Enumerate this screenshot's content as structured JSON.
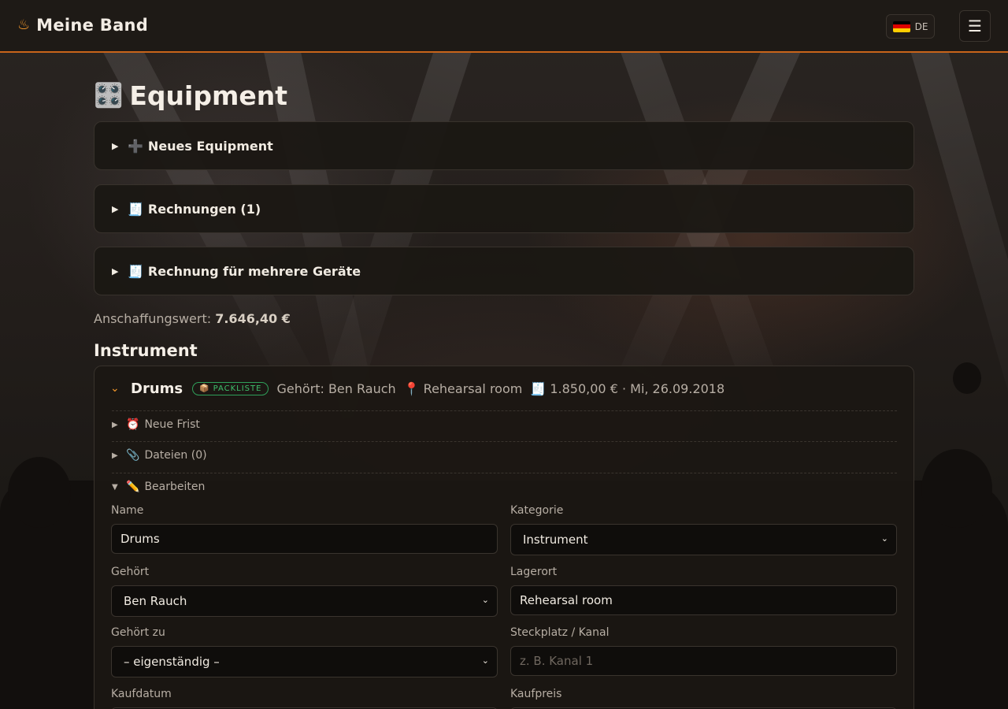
{
  "app": {
    "brand_icon": "♨",
    "brand_title": "Meine Band",
    "lang_label": "DE",
    "flag_colors": [
      "#000000",
      "#dd0000",
      "#ffce00"
    ],
    "menu_icon": "☰",
    "accent": "#c8641a"
  },
  "page": {
    "title_icon": "🎛️",
    "title": "Equipment",
    "panels": [
      {
        "icon": "➕",
        "label": "Neues Equipment"
      },
      {
        "icon": "🧾",
        "label": "Rechnungen (1)"
      },
      {
        "icon": "🧾",
        "label": "Rechnung für mehrere Geräte"
      }
    ],
    "value_label": "Anschaffungswert: ",
    "value_amount": "7.646,40 €",
    "section": "Instrument"
  },
  "item": {
    "name": "Drums",
    "badge_icon": "📦",
    "badge": "PACKLISTE",
    "owner": "Gehört: Ben Rauch",
    "location_icon": "📍",
    "location": "Rehearsal room",
    "invoice_icon": "🧾",
    "invoice": "1.850,00 € · Mi, 26.09.2018",
    "sections": [
      {
        "icon": "⏰",
        "label": "Neue Frist",
        "state": "collapsed"
      },
      {
        "icon": "📎",
        "label": "Dateien (0)",
        "state": "collapsed"
      },
      {
        "icon": "✏️",
        "label": "Bearbeiten",
        "state": "expanded"
      }
    ]
  },
  "form": {
    "name_label": "Name",
    "name_value": "Drums",
    "category_label": "Kategorie",
    "category_value": "Instrument",
    "owner_label": "Gehört",
    "owner_value": "Ben Rauch",
    "storage_label": "Lagerort",
    "storage_value": "Rehearsal room",
    "parent_label": "Gehört zu",
    "parent_value": "– eigenständig –",
    "slot_label": "Steckplatz / Kanal",
    "slot_placeholder": "z. B. Kanal 1",
    "purchase_date_label": "Kaufdatum",
    "price_label": "Kaufpreis"
  }
}
